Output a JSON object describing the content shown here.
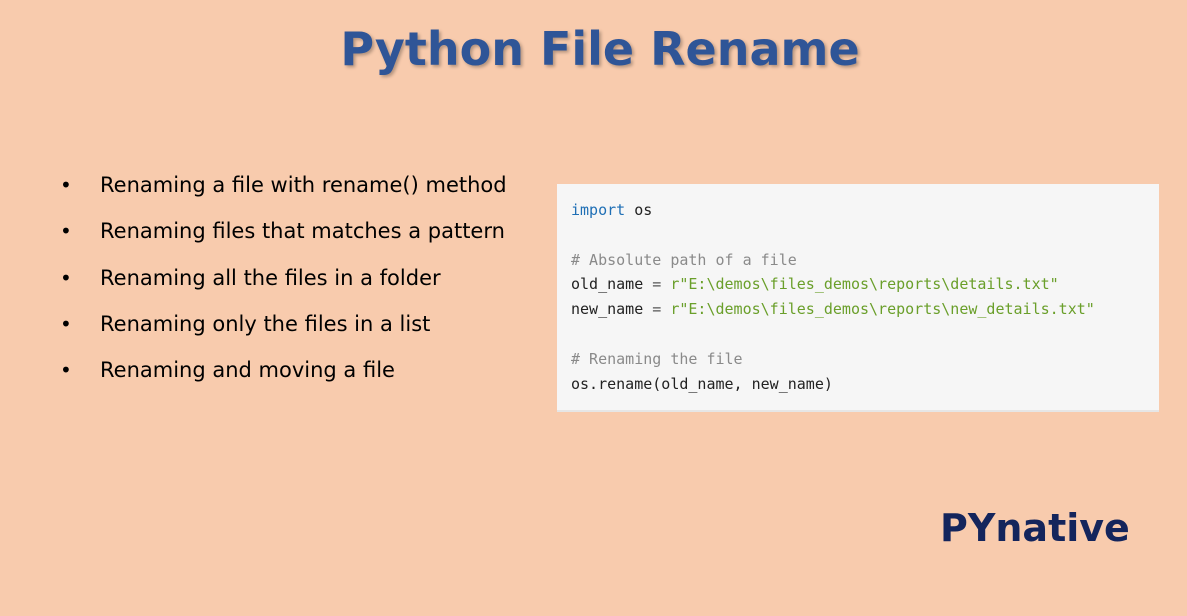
{
  "title": "Python File Rename",
  "bullets": [
    "Renaming a file with rename() method",
    "Renaming files that matches a pattern",
    "Renaming all the files in a folder",
    "Renaming only the files in a list",
    "Renaming and moving a file"
  ],
  "bullet_symbol": "•",
  "code": {
    "import_keyword": "import",
    "import_module": " os",
    "comment1": "# Absolute path of a file",
    "old_var": "old_name",
    "old_eq": " = ",
    "old_value": "r\"E:\\demos\\files_demos\\reports\\details.txt\"",
    "new_var": "new_name",
    "new_eq": " = ",
    "new_value": "r\"E:\\demos\\files_demos\\reports\\new_details.txt\"",
    "comment2": "# Renaming the file",
    "call": "os.rename(old_name, new_name)"
  },
  "brand": "PYnative",
  "colors": {
    "background": "#f8cbad",
    "title": "#2f5597",
    "brand": "#14255c",
    "code_keyword": "#1f6fb5",
    "code_string": "#6a9f2a",
    "code_comment": "#8a8a8a"
  }
}
